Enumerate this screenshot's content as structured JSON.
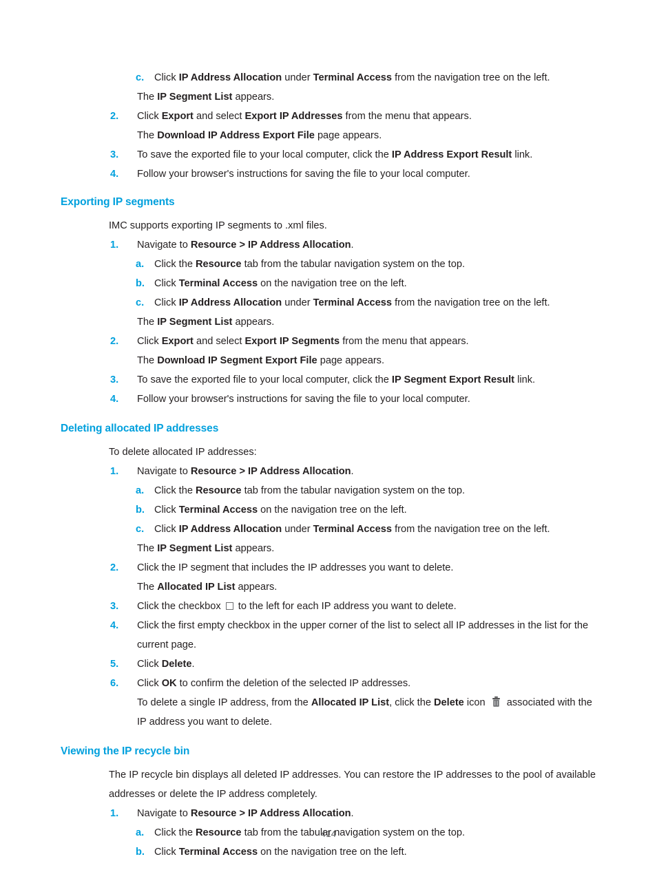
{
  "document": {
    "page_number": "414",
    "heading_color": "#00a0dd",
    "body_color": "#231f20"
  },
  "blocks": {
    "s1_c_pre": "Click ",
    "s1_c_b1": "IP Address Allocation",
    "s1_c_mid": " under ",
    "s1_c_b2": "Terminal Access",
    "s1_c_post": " from the navigation tree on the left.",
    "s1_c_marker": "c.",
    "s1_seglist_pre": "The ",
    "s1_seglist_b": "IP Segment List",
    "s1_seglist_post": " appears.",
    "s1_2_marker": "2.",
    "s1_2_pre": "Click ",
    "s1_2_b1": "Export",
    "s1_2_mid": " and select ",
    "s1_2_b2": "Export IP Addresses",
    "s1_2_post": " from the menu that appears.",
    "s1_dl_pre": "The ",
    "s1_dl_b": "Download IP Address Export File",
    "s1_dl_post": " page appears.",
    "s1_3_marker": "3.",
    "s1_3_pre": "To save the exported file to your local computer, click the ",
    "s1_3_b": "IP Address Export Result",
    "s1_3_post": " link.",
    "s1_4_marker": "4.",
    "s1_4_text": "Follow your browser's instructions for saving the file to your local computer."
  },
  "section_exporting": {
    "heading": "Exporting IP segments",
    "intro": "IMC supports exporting IP segments to .xml files.",
    "step1_marker": "1.",
    "step1_pre": "Navigate to ",
    "step1_b": "Resource > IP Address Allocation",
    "step1_post": ".",
    "a_marker": "a.",
    "a_pre": "Click the ",
    "a_b": "Resource",
    "a_post": " tab from the tabular navigation system on the top.",
    "b_marker": "b.",
    "b_pre": "Click ",
    "b_b": "Terminal Access",
    "b_post": " on the navigation tree on the left.",
    "c_marker": "c.",
    "c_pre": "Click ",
    "c_b1": "IP Address Allocation",
    "c_mid": " under ",
    "c_b2": "Terminal Access",
    "c_post": " from the navigation tree on the left.",
    "seglist_pre": "The ",
    "seglist_b": "IP Segment List",
    "seglist_post": " appears.",
    "step2_marker": "2.",
    "step2_pre": "Click ",
    "step2_b1": "Export",
    "step2_mid": " and select ",
    "step2_b2": "Export IP Segments",
    "step2_post": " from the menu that appears.",
    "dl_pre": "The ",
    "dl_b": "Download IP Segment Export File",
    "dl_post": " page appears.",
    "step3_marker": "3.",
    "step3_pre": "To save the exported file to your local computer, click the ",
    "step3_b": "IP Segment Export Result",
    "step3_post": " link.",
    "step4_marker": "4.",
    "step4_text": "Follow your browser's instructions for saving the file to your local computer."
  },
  "section_deleting": {
    "heading": "Deleting allocated IP addresses",
    "intro": "To delete allocated IP addresses:",
    "step1_marker": "1.",
    "step1_pre": "Navigate to ",
    "step1_b": "Resource > IP Address Allocation",
    "step1_post": ".",
    "a_marker": "a.",
    "a_pre": "Click the ",
    "a_b": "Resource",
    "a_post": " tab from the tabular navigation system on the top.",
    "b_marker": "b.",
    "b_pre": "Click ",
    "b_b": "Terminal Access",
    "b_post": " on the navigation tree on the left.",
    "c_marker": "c.",
    "c_pre": "Click ",
    "c_b1": "IP Address Allocation",
    "c_mid": " under ",
    "c_b2": "Terminal Access",
    "c_post": " from the navigation tree on the left.",
    "seglist_pre": "The ",
    "seglist_b": "IP Segment List",
    "seglist_post": " appears.",
    "step2_marker": "2.",
    "step2_text": "Click the IP segment that includes the IP addresses you want to delete.",
    "alloc_pre": "The ",
    "alloc_b": "Allocated IP List",
    "alloc_post": " appears.",
    "step3_marker": "3.",
    "step3_pre": "Click the checkbox ",
    "step3_post": " to the left for each IP address you want to delete.",
    "step3_icon": "checkbox-icon",
    "step4_marker": "4.",
    "step4_text": "Click the first empty checkbox in the upper corner of the list to select all IP addresses in the list for the current page.",
    "step5_marker": "5.",
    "step5_pre": "Click ",
    "step5_b": "Delete",
    "step5_post": ".",
    "step6_marker": "6.",
    "step6_pre": "Click ",
    "step6_b": "OK",
    "step6_post": " to confirm the deletion of the selected IP addresses.",
    "note_pre": "To delete a single IP address, from the ",
    "note_b1": "Allocated IP List",
    "note_mid": ", click the ",
    "note_b2": "Delete",
    "note_mid2": " icon ",
    "note_post": " associated with the IP address you want to delete.",
    "note_icon": "trash-icon"
  },
  "section_recycle": {
    "heading": "Viewing the IP recycle bin",
    "intro": "The IP recycle bin displays all deleted IP addresses. You can restore the IP addresses to the pool of available addresses or delete the IP address completely.",
    "step1_marker": "1.",
    "step1_pre": "Navigate to ",
    "step1_b": "Resource > IP Address Allocation",
    "step1_post": ".",
    "a_marker": "a.",
    "a_pre": "Click the ",
    "a_b": "Resource",
    "a_post": " tab from the tabular navigation system on the top.",
    "b_marker": "b.",
    "b_pre": "Click ",
    "b_b": "Terminal Access",
    "b_post": " on the navigation tree on the left."
  }
}
